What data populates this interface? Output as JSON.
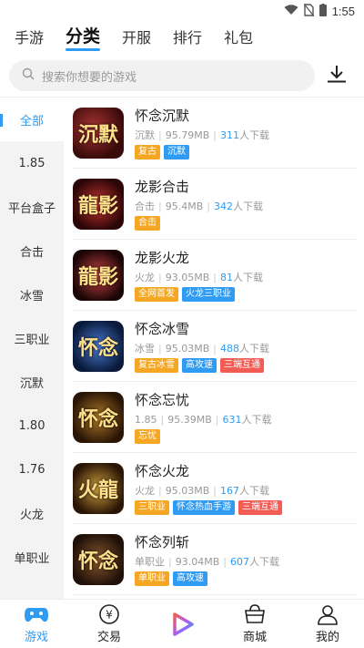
{
  "status_bar": {
    "time": "1:55"
  },
  "top_tabs": [
    {
      "label": "手游",
      "active": false
    },
    {
      "label": "分类",
      "active": true
    },
    {
      "label": "开服",
      "active": false
    },
    {
      "label": "排行",
      "active": false
    },
    {
      "label": "礼包",
      "active": false
    }
  ],
  "search": {
    "placeholder": "搜索你想要的游戏"
  },
  "sidebar": [
    {
      "label": "全部"
    },
    {
      "label": "1.85"
    },
    {
      "label": "平台盒子"
    },
    {
      "label": "合击"
    },
    {
      "label": "冰雪"
    },
    {
      "label": "三职业"
    },
    {
      "label": "沉默"
    },
    {
      "label": "1.80"
    },
    {
      "label": "1.76"
    },
    {
      "label": "火龙"
    },
    {
      "label": "单职业"
    }
  ],
  "colors": {
    "accent": "#2f9bf3",
    "tag_orange": "#f5a623",
    "tag_blue": "#2f9bf3",
    "tag_red": "#f25c54"
  },
  "download_unit": "人下载",
  "games": [
    {
      "name": "怀念沉默",
      "category": "沉默",
      "size": "95.79MB",
      "downloads": "311",
      "tags": [
        {
          "text": "复古",
          "color": "#f5a623"
        },
        {
          "text": "沉默",
          "color": "#2f9bf3"
        }
      ],
      "glyph": "沉默"
    },
    {
      "name": "龙影合击",
      "category": "合击",
      "size": "95.4MB",
      "downloads": "342",
      "tags": [
        {
          "text": "合击",
          "color": "#f5a623"
        }
      ],
      "glyph": "龍影"
    },
    {
      "name": "龙影火龙",
      "category": "火龙",
      "size": "93.05MB",
      "downloads": "81",
      "tags": [
        {
          "text": "全网首发",
          "color": "#f5a623"
        },
        {
          "text": "火龙三职业",
          "color": "#2f9bf3"
        }
      ],
      "glyph": "龍影"
    },
    {
      "name": "怀念冰雪",
      "category": "冰雪",
      "size": "95.03MB",
      "downloads": "488",
      "tags": [
        {
          "text": "复古冰雪",
          "color": "#f5a623"
        },
        {
          "text": "高攻速",
          "color": "#2f9bf3"
        },
        {
          "text": "三端互通",
          "color": "#f25c54"
        }
      ],
      "glyph": "怀念"
    },
    {
      "name": "怀念忘忧",
      "category": "1.85",
      "size": "95.39MB",
      "downloads": "631",
      "tags": [
        {
          "text": "忘忧",
          "color": "#f5a623"
        }
      ],
      "glyph": "怀念"
    },
    {
      "name": "怀念火龙",
      "category": "火龙",
      "size": "95.03MB",
      "downloads": "167",
      "tags": [
        {
          "text": "三职业",
          "color": "#f5a623"
        },
        {
          "text": "怀念热血手游",
          "color": "#2f9bf3"
        },
        {
          "text": "三端互通",
          "color": "#f25c54"
        }
      ],
      "glyph": "火龍"
    },
    {
      "name": "怀念列斩",
      "category": "单职业",
      "size": "93.04MB",
      "downloads": "607",
      "tags": [
        {
          "text": "单职业",
          "color": "#f5a623"
        },
        {
          "text": "高攻速",
          "color": "#2f9bf3"
        }
      ],
      "glyph": "怀念"
    }
  ],
  "bottom_nav": [
    {
      "label": "游戏",
      "icon": "gamepad-icon",
      "active": true
    },
    {
      "label": "交易",
      "icon": "yen-icon",
      "active": false
    },
    {
      "label": "",
      "icon": "play-icon",
      "active": false
    },
    {
      "label": "商城",
      "icon": "shop-icon",
      "active": false
    },
    {
      "label": "我的",
      "icon": "user-icon",
      "active": false
    }
  ]
}
